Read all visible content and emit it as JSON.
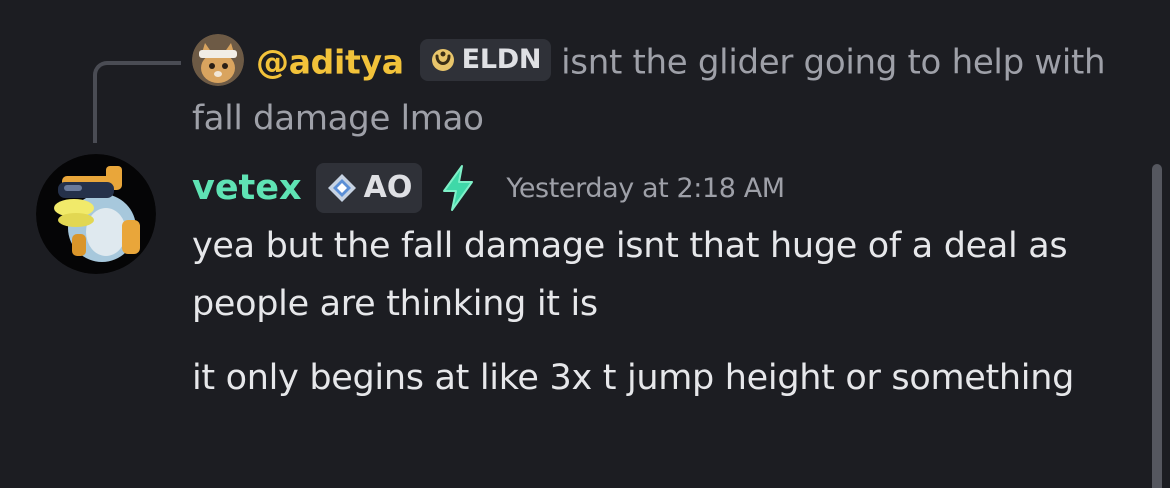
{
  "reply": {
    "username": "@aditya",
    "tag_label": "ELDN",
    "text": "isnt the glider going to help with fall damage lmao",
    "avatar_icon": "cat-avatar-icon",
    "tag_icon": "horseshoe-icon"
  },
  "message": {
    "author": "vetex",
    "tag_label": "AO",
    "tag_icon": "diamond-star-icon",
    "boost_icon": "lightning-bolt-icon",
    "timestamp": "Yesterday at 2:18 AM",
    "lines": [
      "yea but the fall damage isnt that huge of a deal as people are thinking it is",
      "it only begins at like 3x t jump height or something"
    ]
  },
  "colors": {
    "background": "#1c1d22",
    "reply_username": "#f2c23a",
    "author": "#5fe3b4",
    "muted_text": "#9ea0a8",
    "message_text": "#e6e7ea",
    "tag_background": "#2f3138"
  }
}
